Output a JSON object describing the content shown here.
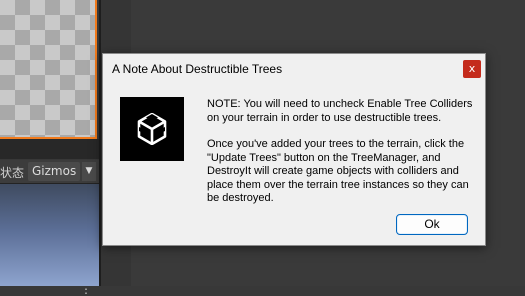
{
  "editor": {
    "more_icon": "⋮",
    "game_toolbar_text": "状态",
    "gizmos_label": "Gizmos",
    "gizmos_dropdown_icon": "▼"
  },
  "dialog": {
    "title": "A Note About Destructible Trees",
    "close_label": "x",
    "icon": "unity-logo-icon",
    "paragraph1": "NOTE: You will need to uncheck Enable Tree Colliders on your terrain in order to use destructible trees.",
    "paragraph2": "Once you've added your trees to the terrain, click the \"Update Trees\" button on the TreeManager, and DestroyIt will create game objects with colliders and place them over the terrain tree instances so they can be destroyed.",
    "ok_label": "Ok"
  },
  "colors": {
    "accent_orange": "#f07a1c",
    "close_red": "#c42b1c",
    "ok_border": "#0067c0"
  }
}
